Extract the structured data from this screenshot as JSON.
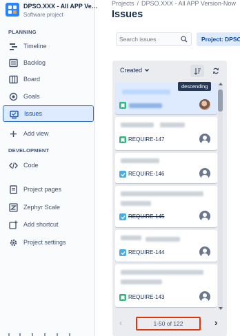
{
  "project": {
    "name": "DPSO.XXX - All APP Version-Now",
    "type": "Software project"
  },
  "sidebar": {
    "planning_label": "PLANNING",
    "development_label": "DEVELOPMENT",
    "items": [
      {
        "label": "Timeline",
        "icon": "timeline-icon"
      },
      {
        "label": "Backlog",
        "icon": "backlog-icon"
      },
      {
        "label": "Board",
        "icon": "board-icon"
      },
      {
        "label": "Goals",
        "icon": "goals-icon"
      },
      {
        "label": "Issues",
        "icon": "issues-icon",
        "active": true
      },
      {
        "label": "Add view",
        "icon": "plus-icon"
      },
      {
        "label": "Code",
        "icon": "code-icon"
      },
      {
        "label": "Project pages",
        "icon": "pages-icon"
      },
      {
        "label": "Zephyr Scale",
        "icon": "zephyr-icon"
      },
      {
        "label": "Add shortcut",
        "icon": "add-shortcut-icon"
      },
      {
        "label": "Project settings",
        "icon": "gear-icon"
      }
    ]
  },
  "breadcrumbs": {
    "root": "Projects",
    "separator": "/",
    "current": "DPSO.XXX - All APP Version-Now"
  },
  "page": {
    "title": "Issues"
  },
  "search": {
    "placeholder": "Search issues"
  },
  "filter": {
    "project_label": "Project: DPSO"
  },
  "list": {
    "sort_label": "Created",
    "tooltip": "descending",
    "cards": [
      {
        "key": "",
        "type": "story",
        "selected": true,
        "avatar": "photo"
      },
      {
        "key": "REQUIRE-147",
        "type": "story",
        "done": false,
        "avatar": "default"
      },
      {
        "key": "REQUIRE-146",
        "type": "task",
        "done": false,
        "avatar": "default"
      },
      {
        "key": "REQUIRE-145",
        "type": "task",
        "done": true,
        "avatar": "default"
      },
      {
        "key": "REQUIRE-144",
        "type": "task",
        "done": false,
        "avatar": "default"
      },
      {
        "key": "REQUIRE-143",
        "type": "story",
        "done": false,
        "avatar": "default"
      }
    ]
  },
  "pagination": {
    "label": "1-50 of 122",
    "prev": "‹",
    "next": "›"
  },
  "colors": {
    "accent": "#0052cc",
    "story": "#36b37e",
    "task": "#4bade8",
    "highlight": "#de350b"
  }
}
